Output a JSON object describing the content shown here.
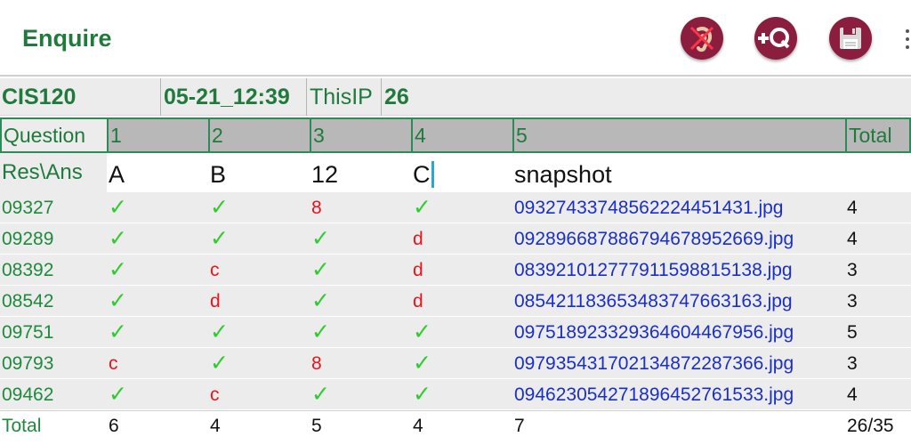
{
  "appbar": {
    "title": "Enquire",
    "actions": [
      {
        "name": "mute",
        "icon": "ear-muted-icon"
      },
      {
        "name": "add_question",
        "label": "+Q",
        "icon": "add-question-icon"
      },
      {
        "name": "save",
        "icon": "floppy-disk-icon"
      }
    ],
    "overflow_icon": "more-vert-icon"
  },
  "info": {
    "course": "CIS120",
    "timestamp": "05-21_12:39",
    "ip_label": "ThisIP",
    "ip_value": "26"
  },
  "table": {
    "header_label": "Question",
    "columns": [
      "1",
      "2",
      "3",
      "4",
      "5",
      "Total"
    ],
    "answer_label": "Res\\Ans",
    "answers": [
      "A",
      "B",
      "12",
      "C",
      "snapshot"
    ],
    "correct_mark": "✓",
    "rows": [
      {
        "id": "09327",
        "r": [
          "✓",
          "✓",
          "8",
          "✓"
        ],
        "file": "09327433748562224451431.jpg",
        "total": "4"
      },
      {
        "id": "09289",
        "r": [
          "✓",
          "✓",
          "✓",
          "d"
        ],
        "file": "09289668788679467895 2669.jpg",
        "total": "4"
      },
      {
        "id": "08392",
        "r": [
          "✓",
          "c",
          "✓",
          "d"
        ],
        "file": "08392101277791159881513 8.jpg",
        "total": "3"
      },
      {
        "id": "08542",
        "r": [
          "✓",
          "d",
          "✓",
          "d"
        ],
        "file": "08542118365348374766316 3.jpg",
        "total": "3"
      },
      {
        "id": "09751",
        "r": [
          "✓",
          "✓",
          "✓",
          "✓"
        ],
        "file": "09751892332936460446795 6.jpg",
        "total": "5"
      },
      {
        "id": "09793",
        "r": [
          "c",
          "✓",
          "8",
          "✓"
        ],
        "file": "09793543170213487228736 6.jpg",
        "total": "3"
      },
      {
        "id": "09462",
        "r": [
          "✓",
          "c",
          "✓",
          "✓"
        ],
        "file": "09462305427189645276153 3.jpg",
        "total": "4"
      }
    ],
    "totals_label": "Total",
    "totals": [
      "6",
      "4",
      "5",
      "4",
      "7",
      "26/35"
    ]
  },
  "colors": {
    "accent_green": "#1f7a3c",
    "correct_green": "#2ecc2e",
    "wrong_red": "#e8141c",
    "link_blue": "#1a2fc9",
    "action_maroon": "#8b1e3f"
  }
}
